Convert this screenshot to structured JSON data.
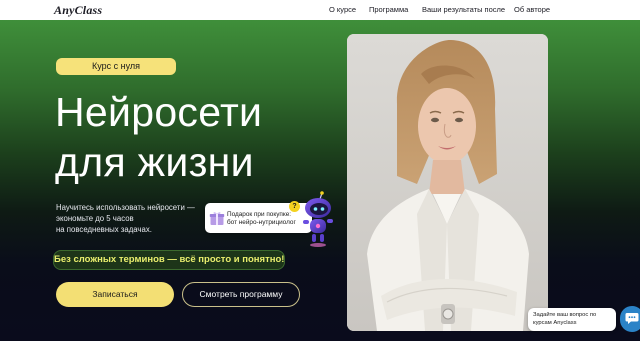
{
  "header": {
    "logo": "AnyClass",
    "nav": [
      "О курсе",
      "Программа",
      "Ваши результаты после",
      "Об авторе"
    ]
  },
  "hero": {
    "badge": "Курс с нуля",
    "title_line1": "Нейросети",
    "title_line2": "для жизни",
    "description": [
      "Научитесь использовать нейросети —",
      "экономьте до 5 часов",
      "на повседневных задачах."
    ],
    "pill": "Без сложных терминов — всё просто и понятно!",
    "primary_button": "Записаться",
    "secondary_button": "Смотреть программу",
    "gift": {
      "line1": "Подарок при покупке:",
      "line2": "бот нейро-нутрициолог",
      "question_mark": "?"
    }
  },
  "chat": {
    "line1": "Задайте ваш вопрос по",
    "line2": "курсам Anyclass"
  },
  "colors": {
    "accent_yellow": "#f3df74",
    "hero_green": "#3f8f3a",
    "hero_dark": "#0a0b1c",
    "chat_blue": "#2b83c7"
  },
  "icons": [
    "gift-icon",
    "robot-icon",
    "question-icon",
    "chat-icon"
  ]
}
